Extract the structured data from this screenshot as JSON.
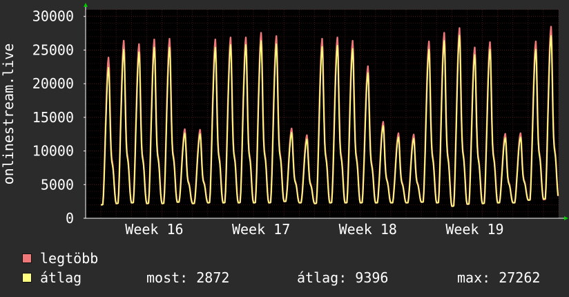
{
  "chart_data": {
    "type": "area",
    "ylabel": "onlinestream.live",
    "ylim": [
      0,
      31000
    ],
    "yticks": [
      0,
      5000,
      10000,
      15000,
      20000,
      25000,
      30000
    ],
    "ytick_labels": [
      "0",
      "5000",
      "10000",
      "15000",
      "20000",
      "25000",
      "30000"
    ],
    "xtick_labels": [
      "Week 16",
      "Week 17",
      "Week 18",
      "Week 19"
    ],
    "x_range_days": [
      0,
      31
    ],
    "xtick_days": [
      4.5,
      11.5,
      18.5,
      25.5
    ],
    "grid": true,
    "colors": {
      "background": "#2b2b2b",
      "plot_background": "#000000",
      "grid": "#5a2020",
      "series_max": "#f07878",
      "series_avg": "#ffff80",
      "axis": "#ffffff",
      "arrow": "#00cc00"
    },
    "series": [
      {
        "name": "legtöbb",
        "color": "#f07878",
        "daily_peaks": [
          24000,
          26500,
          26000,
          26700,
          26800,
          13300,
          13200,
          26700,
          27000,
          27000,
          27700,
          27200,
          13400,
          12400,
          26800,
          27000,
          26500,
          22700,
          14400,
          12700,
          12500,
          26400,
          27700,
          28400,
          25500,
          26300,
          12600,
          12700,
          26400,
          28600
        ],
        "daily_troughs": [
          2000,
          2200,
          2300,
          2200,
          2200,
          2400,
          2200,
          2300,
          2300,
          2300,
          2300,
          2300,
          2500,
          2300,
          2200,
          2300,
          2300,
          2300,
          2300,
          2300,
          2300,
          2400,
          2300,
          1800,
          2100,
          2200,
          2300,
          2300,
          2700,
          2800
        ]
      },
      {
        "name": "átlag",
        "color": "#ffff80",
        "daily_peaks": [
          22500,
          25200,
          24800,
          25500,
          25500,
          12700,
          12600,
          25500,
          25900,
          25900,
          26500,
          26000,
          12800,
          11800,
          25600,
          25800,
          25300,
          21700,
          13800,
          12100,
          11900,
          25200,
          26500,
          27300,
          24400,
          25200,
          12000,
          12100,
          25200,
          27262
        ],
        "daily_troughs": [
          2000,
          2200,
          2300,
          2200,
          2200,
          2400,
          2200,
          2300,
          2300,
          2300,
          2300,
          2300,
          2500,
          2300,
          2200,
          2300,
          2300,
          2300,
          2300,
          2300,
          2300,
          2400,
          2300,
          1800,
          2100,
          2200,
          2300,
          2300,
          2700,
          2872
        ]
      }
    ]
  },
  "legend": {
    "max_label": "legtöbb",
    "avg_label": "átlag"
  },
  "stats": {
    "current": "most: 2872",
    "average": "átlag: 9396",
    "maximum": "max: 27262"
  }
}
